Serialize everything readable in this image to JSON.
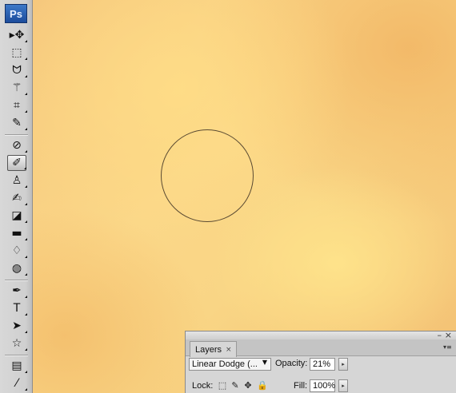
{
  "app": {
    "logo_text": "Ps"
  },
  "toolbox": {
    "tools": [
      {
        "name": "move-tool",
        "glyph": "▸✥"
      },
      {
        "name": "marquee-tool",
        "glyph": "⬚"
      },
      {
        "name": "lasso-tool",
        "glyph": "ᗢ"
      },
      {
        "name": "magic-wand-tool",
        "glyph": "⚚"
      },
      {
        "name": "crop-tool",
        "glyph": "⌗"
      },
      {
        "name": "eyedropper-tool",
        "glyph": "✎"
      },
      {
        "name": "healing-brush-tool",
        "glyph": "⊘"
      },
      {
        "name": "brush-tool",
        "glyph": "✐",
        "active": true
      },
      {
        "name": "clone-stamp-tool",
        "glyph": "♙"
      },
      {
        "name": "history-brush-tool",
        "glyph": "✍"
      },
      {
        "name": "eraser-tool",
        "glyph": "◪"
      },
      {
        "name": "gradient-tool",
        "glyph": "▬"
      },
      {
        "name": "blur-tool",
        "glyph": "♢"
      },
      {
        "name": "dodge-tool",
        "glyph": "◍"
      },
      {
        "name": "pen-tool",
        "glyph": "✒"
      },
      {
        "name": "type-tool",
        "glyph": "T"
      },
      {
        "name": "path-selection-tool",
        "glyph": "➤"
      },
      {
        "name": "shape-tool",
        "glyph": "☆"
      },
      {
        "name": "notes-tool",
        "glyph": "▤"
      },
      {
        "name": "eyedropper-sample-tool",
        "glyph": "⁄"
      }
    ]
  },
  "layers_panel": {
    "tab_label": "Layers",
    "tab_close": "×",
    "minimize_glyph": "–",
    "close_glyph": "×",
    "menu_glyph": "▾≡",
    "blend_mode": "Linear Dodge (...",
    "blend_arrow": "▼",
    "opacity_label": "Opacity:",
    "opacity_value": "21%",
    "fill_label": "Fill:",
    "fill_value": "100%",
    "lock_label": "Lock:",
    "flyout_glyph": "▸",
    "lock_icons": [
      {
        "name": "lock-transparent-icon",
        "glyph": "⬚"
      },
      {
        "name": "lock-image-icon",
        "glyph": "✎"
      },
      {
        "name": "lock-position-icon",
        "glyph": "✥"
      },
      {
        "name": "lock-all-icon",
        "glyph": "🔒"
      }
    ]
  },
  "colors": {
    "canvas_base": "#f9d585",
    "canvas_edge": "#f3bf72",
    "brush_cursor": "#5a4a32",
    "logo_blue": "#1c4c9c"
  }
}
